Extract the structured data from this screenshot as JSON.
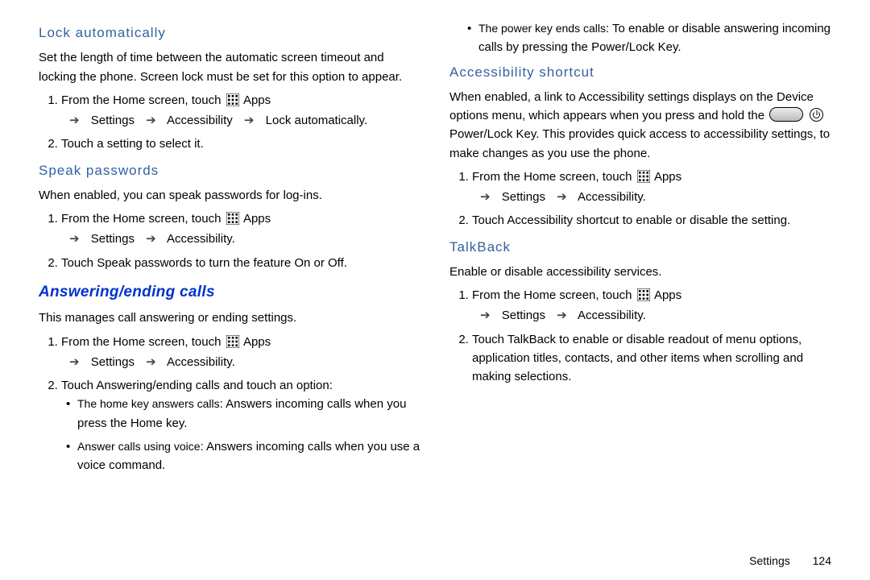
{
  "left": {
    "h_lock": "Lock automatically",
    "lock_p": "Set the length of time between the automatic screen timeout and locking the phone. Screen lock must be set for this option to appear.",
    "step_prefix": "From the Home screen, touch ",
    "apps_word": "Apps",
    "trail_sett": "Settings",
    "trail_acc": "Accessibility",
    "trail_lock": "Lock automatically",
    "lock_step2": "Touch a setting to select it.",
    "h_speak": "Speak passwords",
    "speak_p": "When enabled, you can speak passwords for log-ins.",
    "speak_step2": "Touch Speak passwords to turn the feature On or Off.",
    "h_calls": "Answering/ending calls",
    "calls_p": "This manages call answering or ending settings.",
    "calls_step2": "Touch Answering/ending calls and touch an option:",
    "b1_term": "The home key answers calls",
    "b1_rest": ": Answers incoming calls when you press the Home key.",
    "b2_term": "Answer calls using voice",
    "b2_rest": ": Answers incoming calls when you use a voice command."
  },
  "right": {
    "b3_term": "The power key ends calls",
    "b3_rest": ": To enable or disable answering incoming calls by pressing the Power/Lock Key.",
    "h_short": "Accessibility shortcut",
    "short_p1": "When enabled, a link to Accessibility settings displays on the Device options menu, which appears when you press and hold the ",
    "short_p2": " Power/Lock Key. This provides quick access to accessibility settings, to make changes as you use the phone.",
    "short_step2": "Touch Accessibility shortcut to enable or disable the setting.",
    "h_talk": "TalkBack",
    "talk_p": "Enable or disable accessibility services.",
    "talk_step2": "Touch TalkBack to enable or disable readout of menu options, application titles, contacts, and other items when scrolling and making selections."
  },
  "footer": {
    "label": "Settings",
    "page": "124"
  }
}
